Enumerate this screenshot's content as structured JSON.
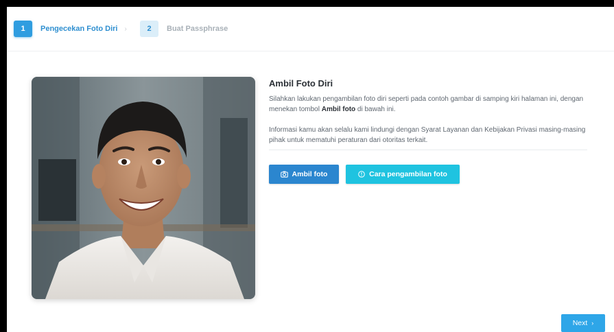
{
  "stepper": {
    "steps": [
      {
        "number": "1",
        "label": "Pengecekan Foto Diri",
        "state": "active"
      },
      {
        "number": "2",
        "label": "Buat Passphrase",
        "state": "inactive"
      }
    ],
    "separator": "›"
  },
  "photo": {
    "alt": "example-selfie-photo"
  },
  "main": {
    "title": "Ambil Foto Diri",
    "instruction_pre": "Silahkan lakukan pengambilan foto diri seperti pada contoh gambar di samping kiri halaman ini, dengan menekan tombol ",
    "instruction_bold": "Ambil foto",
    "instruction_post": " di bawah ini.",
    "privacy_text": "Informasi kamu akan selalu kami lindungi dengan Syarat Layanan dan Kebijakan Privasi masing-masing pihak untuk mematuhi peraturan dari otoritas terkait."
  },
  "buttons": {
    "take_photo": "Ambil foto",
    "take_photo_icon": "camera-icon",
    "how_to": "Cara pengambilan foto",
    "how_to_icon": "info-icon",
    "next": "Next",
    "next_icon": "chevron-right-icon"
  },
  "colors": {
    "primary": "#2b86cf",
    "info": "#1fc3e0",
    "step_active": "#2f9de0",
    "next": "#2ea6e8"
  }
}
